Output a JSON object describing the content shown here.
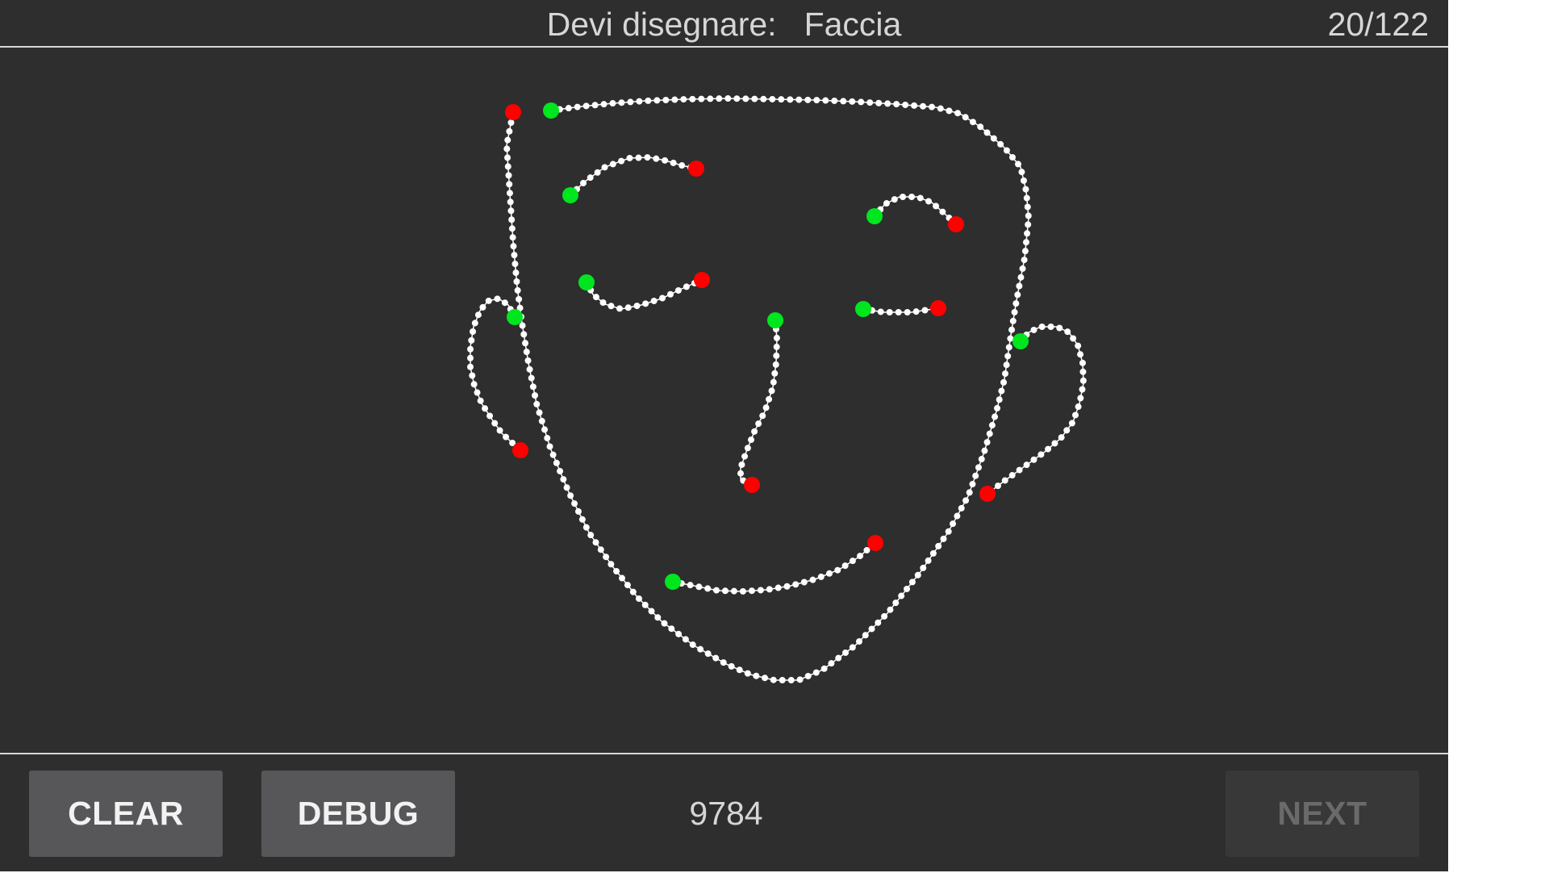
{
  "header": {
    "prompt_label": "Devi disegnare:",
    "prompt_target": "Faccia",
    "counter": "20/122"
  },
  "footer": {
    "clear_label": "CLEAR",
    "debug_label": "DEBUG",
    "score": "9784",
    "next_label": "NEXT"
  },
  "colors": {
    "background": "#2e2e2e",
    "stroke": "#ffffff",
    "stroke_start": "#00e61e",
    "stroke_end": "#ff0000",
    "button": "#575759",
    "button_disabled": "#383838"
  }
}
